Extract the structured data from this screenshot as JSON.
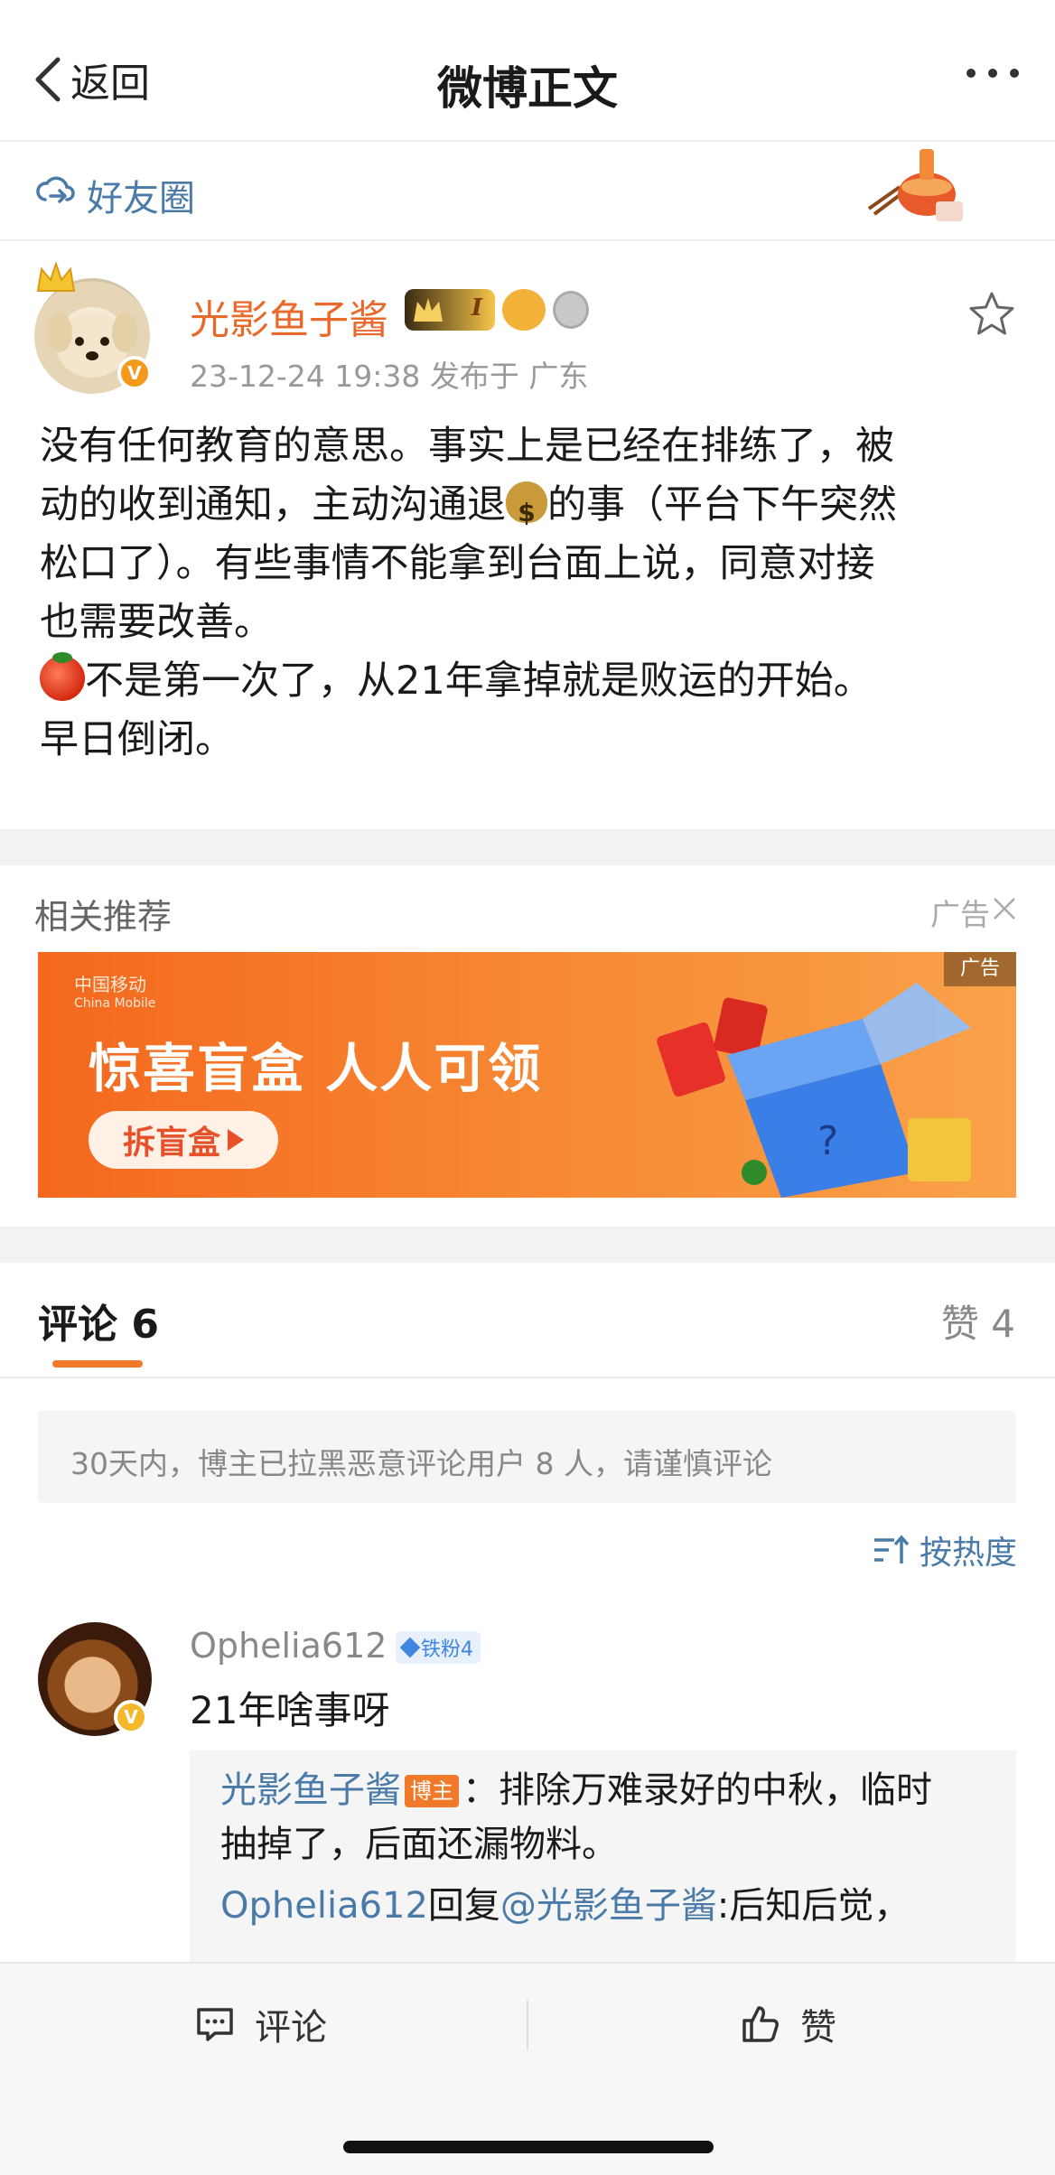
{
  "nav": {
    "back_label": "返回",
    "title": "微博正文"
  },
  "circle": {
    "label": "好友圈"
  },
  "post": {
    "author": "光影鱼子酱",
    "vip_level": "I",
    "meta": "23-12-24 19:38  发布于 广东",
    "lines": [
      {
        "text": "没有任何教育的意思。事实上是已经在排练了，被"
      },
      {
        "text": "动的收到通知，主动沟通退",
        "emoji": "money-bag",
        "after": "的事（平台下午突然"
      },
      {
        "text": "松口了）。有些事情不能拿到台面上说，同意对接"
      },
      {
        "text": "也需要改善。"
      },
      {
        "emoji_before": "tomato",
        "text": "不是第一次了，从21年拿掉就是败运的开始。"
      },
      {
        "text": "早日倒闭。"
      }
    ]
  },
  "related": {
    "title": "相关推荐",
    "ad_tag": "广告",
    "banner": {
      "logo": "中国移动",
      "logo_sub": "China Mobile",
      "headline": "惊喜盲盒 人人可领",
      "button": "拆盲盒",
      "ad_label": "广告"
    }
  },
  "comments": {
    "tab_label": "评论 6",
    "likes_label": "赞 4",
    "notice": "30天内，博主已拉黑恶意评论用户 8 人，请谨慎评论",
    "sort_label": "按热度",
    "items": [
      {
        "user": "Ophelia612",
        "fan_badge": "铁粉4",
        "text": "21年啥事呀",
        "replies": {
          "author": "光影鱼子酱",
          "host_badge": "博主",
          "line1": "：排除万难录好的中秋，临时",
          "line2": "抽掉了，后面还漏物料。",
          "reply_user": "Ophelia612",
          "reply_mid": "回复",
          "reply_target": "@光影鱼子酱",
          "reply_text": ":后知后觉，"
        }
      }
    ]
  },
  "bottom": {
    "comment_label": "评论",
    "like_label": "赞"
  },
  "colors": {
    "accent": "#f07a2a",
    "link": "#4a7aa8",
    "author": "#e8692a"
  }
}
